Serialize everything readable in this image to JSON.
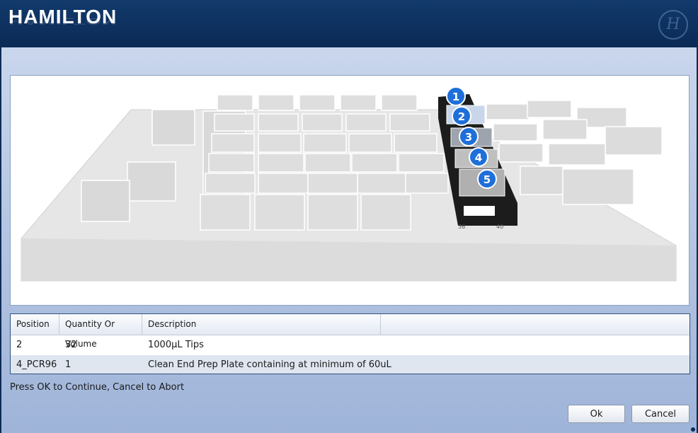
{
  "header": {
    "logo_text": "HAMILTON",
    "emblem_glyph": "H"
  },
  "deck": {
    "markers": [
      "1",
      "2",
      "3",
      "4",
      "5"
    ],
    "track_labels": [
      "36",
      "40"
    ],
    "marker_color": "#1e6fd9"
  },
  "table": {
    "columns": [
      "Position",
      "Quantity Or Volume",
      "Description",
      ""
    ],
    "rows": [
      {
        "position": "2",
        "quantity": "32",
        "description": "1000µL Tips"
      },
      {
        "position": "4_PCR96",
        "quantity": "1",
        "description": "Clean End Prep Plate containing at minimum of 60uL"
      }
    ]
  },
  "footer": {
    "instruction": "Press OK to Continue, Cancel to Abort",
    "ok_label": "Ok",
    "cancel_label": "Cancel"
  }
}
